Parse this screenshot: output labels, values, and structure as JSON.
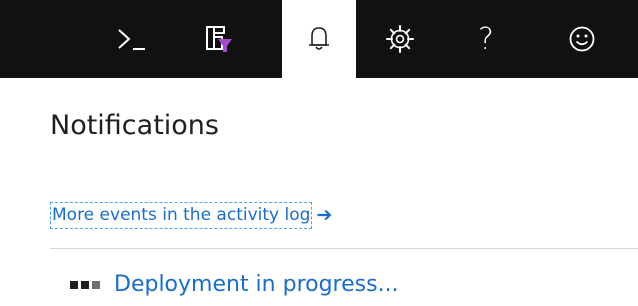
{
  "topbar": {
    "icons": [
      {
        "name": "cloud-shell-icon",
        "active": false
      },
      {
        "name": "directory-filter-icon",
        "active": false
      },
      {
        "name": "notifications-bell-icon",
        "active": true
      },
      {
        "name": "settings-gear-icon",
        "active": false
      },
      {
        "name": "help-question-icon",
        "active": false
      },
      {
        "name": "feedback-smiley-icon",
        "active": false
      }
    ],
    "help_glyph": "?",
    "background_color": "#111111",
    "active_background_color": "#ffffff"
  },
  "panel": {
    "title": "Notifications",
    "activity_link_label": "More events in the activity log",
    "activity_link_arrow": "➔",
    "link_color": "#1a6dce"
  },
  "notifications": [
    {
      "label": "Deployment in progress...",
      "status": "in-progress"
    }
  ]
}
